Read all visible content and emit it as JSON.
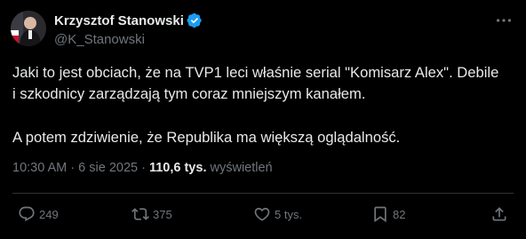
{
  "author": {
    "name": "Krzysztof Stanowski",
    "handle": "@K_Stanowski",
    "verified_icon": "verified-badge-icon",
    "avatar_icon": "avatar"
  },
  "tweet": {
    "line1": "Jaki to jest obciach, że na TVP1 leci właśnie serial \"Komisarz Alex\". Debile",
    "line2": "i szkodnicy zarządzają tym coraz mniejszym kanałem.",
    "line3": "A potem zdziwienie, że Republika ma większą oglądalność."
  },
  "meta": {
    "time": "10:30 AM",
    "separator1": " · ",
    "date": "6 sie 2025",
    "separator2": " · ",
    "views_count": "110,6 tys.",
    "views_label": " wyświetleń"
  },
  "actions": {
    "reply": {
      "icon": "reply-icon",
      "count": "249"
    },
    "retweet": {
      "icon": "retweet-icon",
      "count": "375"
    },
    "like": {
      "icon": "heart-icon",
      "count": "5 tys."
    },
    "bookmark": {
      "icon": "bookmark-icon",
      "count": "82"
    },
    "share": {
      "icon": "share-icon"
    }
  },
  "colors": {
    "background": "#000000",
    "text_primary": "#e7e9ea",
    "text_secondary": "#71767b",
    "verified_blue": "#1d9bf0",
    "divider": "#2f3336"
  }
}
